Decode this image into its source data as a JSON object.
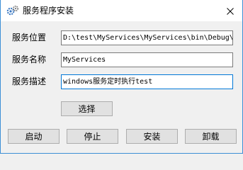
{
  "window": {
    "title": "服务程序安装",
    "app_icon": "gear-icon",
    "close_icon": "close-icon"
  },
  "fields": {
    "location_label": "服务位置",
    "location_value": "D:\\test\\MyServices\\MyServices\\bin\\Debug\\",
    "name_label": "服务名称",
    "name_value": "MyServices",
    "description_label": "服务描述",
    "description_value": "windows服务定时执行test"
  },
  "buttons": {
    "select": "选择",
    "start": "启动",
    "stop": "停止",
    "install": "安装",
    "uninstall": "卸载"
  },
  "colors": {
    "window_border": "#3c8fd6",
    "focus_border": "#0078d7",
    "button_face": "#e1e1e1"
  }
}
